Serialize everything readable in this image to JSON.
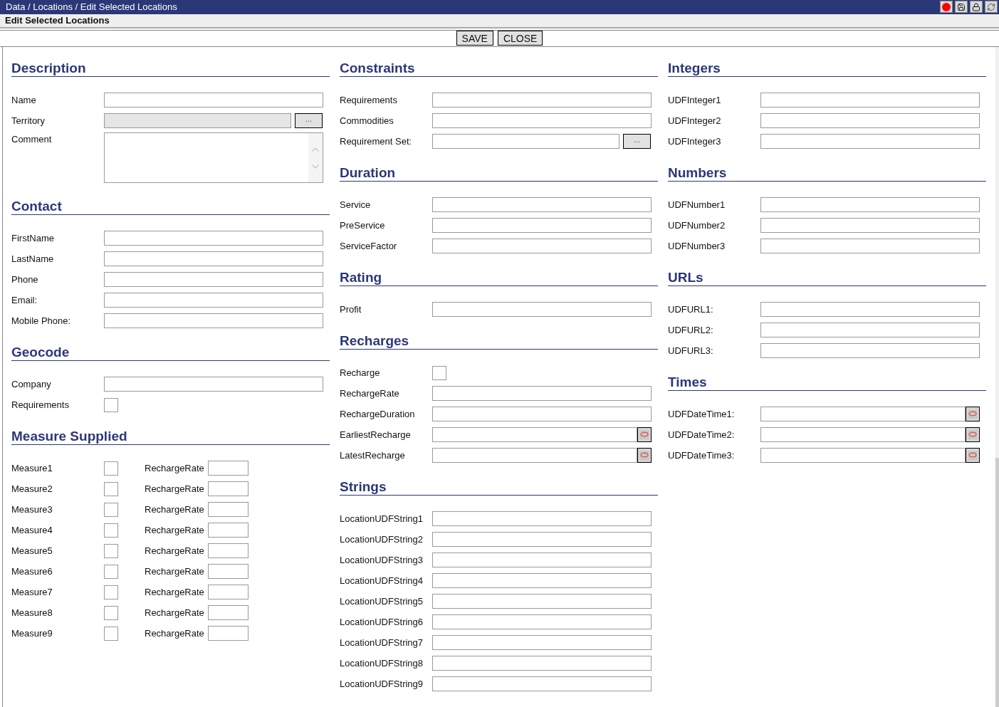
{
  "title_bar": {
    "breadcrumb": "Data / Locations / Edit Selected Locations"
  },
  "subtitle": "Edit Selected Locations",
  "toolbar": {
    "buttons": [
      "SAVE",
      "CLOSE"
    ]
  },
  "columns": [
    [
      {
        "title": "Description",
        "fields": [
          {
            "kind": "text",
            "label": "Name"
          },
          {
            "kind": "lookup",
            "label": "Territory",
            "button": "..."
          },
          {
            "kind": "textarea",
            "label": "Comment"
          }
        ]
      },
      {
        "title": "Contact",
        "fields": [
          {
            "kind": "text",
            "label": "FirstName"
          },
          {
            "kind": "text",
            "label": "LastName"
          },
          {
            "kind": "text",
            "label": "Phone"
          },
          {
            "kind": "text",
            "label": "Email:"
          },
          {
            "kind": "text",
            "label": "Mobile Phone:"
          }
        ]
      },
      {
        "title": "Geocode",
        "fields": [
          {
            "kind": "text",
            "label": "Company"
          },
          {
            "kind": "checkbox",
            "label": "Requirements",
            "checked": false
          }
        ]
      },
      {
        "title": "Measure Supplied",
        "fields": [
          {
            "kind": "measure",
            "label": "Measure1",
            "checked": false,
            "rate_label": "RechargeRate"
          },
          {
            "kind": "measure",
            "label": "Measure2",
            "checked": false,
            "rate_label": "RechargeRate"
          },
          {
            "kind": "measure",
            "label": "Measure3",
            "checked": false,
            "rate_label": "RechargeRate"
          },
          {
            "kind": "measure",
            "label": "Measure4",
            "checked": false,
            "rate_label": "RechargeRate"
          },
          {
            "kind": "measure",
            "label": "Measure5",
            "checked": false,
            "rate_label": "RechargeRate"
          },
          {
            "kind": "measure",
            "label": "Measure6",
            "checked": false,
            "rate_label": "RechargeRate"
          },
          {
            "kind": "measure",
            "label": "Measure7",
            "checked": false,
            "rate_label": "RechargeRate"
          },
          {
            "kind": "measure",
            "label": "Measure8",
            "checked": false,
            "rate_label": "RechargeRate"
          },
          {
            "kind": "measure",
            "label": "Measure9",
            "checked": false,
            "rate_label": "RechargeRate"
          }
        ]
      }
    ],
    [
      {
        "title": "Constraints",
        "fields": [
          {
            "kind": "text",
            "label": "Requirements"
          },
          {
            "kind": "text",
            "label": "Commodities"
          },
          {
            "kind": "lookup_enabled",
            "label": "Requirement Set:",
            "button": "..."
          }
        ]
      },
      {
        "title": "Duration",
        "fields": [
          {
            "kind": "text",
            "label": "Service"
          },
          {
            "kind": "text",
            "label": "PreService"
          },
          {
            "kind": "text",
            "label": "ServiceFactor"
          }
        ]
      },
      {
        "title": "Rating",
        "fields": [
          {
            "kind": "text",
            "label": "Profit"
          }
        ]
      },
      {
        "title": "Recharges",
        "fields": [
          {
            "kind": "checkbox",
            "label": "Recharge",
            "checked": false
          },
          {
            "kind": "text",
            "label": "RechargeRate"
          },
          {
            "kind": "text",
            "label": "RechargeDuration"
          },
          {
            "kind": "date",
            "label": "EarliestRecharge"
          },
          {
            "kind": "date",
            "label": "LatestRecharge"
          }
        ]
      },
      {
        "title": "Strings",
        "fields": [
          {
            "kind": "text",
            "label": "LocationUDFString1"
          },
          {
            "kind": "text",
            "label": "LocationUDFString2"
          },
          {
            "kind": "text",
            "label": "LocationUDFString3"
          },
          {
            "kind": "text",
            "label": "LocationUDFString4"
          },
          {
            "kind": "text",
            "label": "LocationUDFString5"
          },
          {
            "kind": "text",
            "label": "LocationUDFString6"
          },
          {
            "kind": "text",
            "label": "LocationUDFString7"
          },
          {
            "kind": "text",
            "label": "LocationUDFString8"
          },
          {
            "kind": "text",
            "label": "LocationUDFString9"
          }
        ]
      }
    ],
    [
      {
        "title": "Integers",
        "fields": [
          {
            "kind": "text",
            "label": "UDFInteger1"
          },
          {
            "kind": "text",
            "label": "UDFInteger2"
          },
          {
            "kind": "text",
            "label": "UDFInteger3"
          }
        ]
      },
      {
        "title": "Numbers",
        "fields": [
          {
            "kind": "text",
            "label": "UDFNumber1"
          },
          {
            "kind": "text",
            "label": "UDFNumber2"
          },
          {
            "kind": "text",
            "label": "UDFNumber3"
          }
        ]
      },
      {
        "title": "URLs",
        "fields": [
          {
            "kind": "text",
            "label": "UDFURL1:"
          },
          {
            "kind": "text",
            "label": "UDFURL2:"
          },
          {
            "kind": "text",
            "label": "UDFURL3:"
          }
        ]
      },
      {
        "title": "Times",
        "fields": [
          {
            "kind": "date",
            "label": "UDFDateTime1:"
          },
          {
            "kind": "date",
            "label": "UDFDateTime2:"
          },
          {
            "kind": "date",
            "label": "UDFDateTime3:"
          }
        ]
      }
    ]
  ]
}
